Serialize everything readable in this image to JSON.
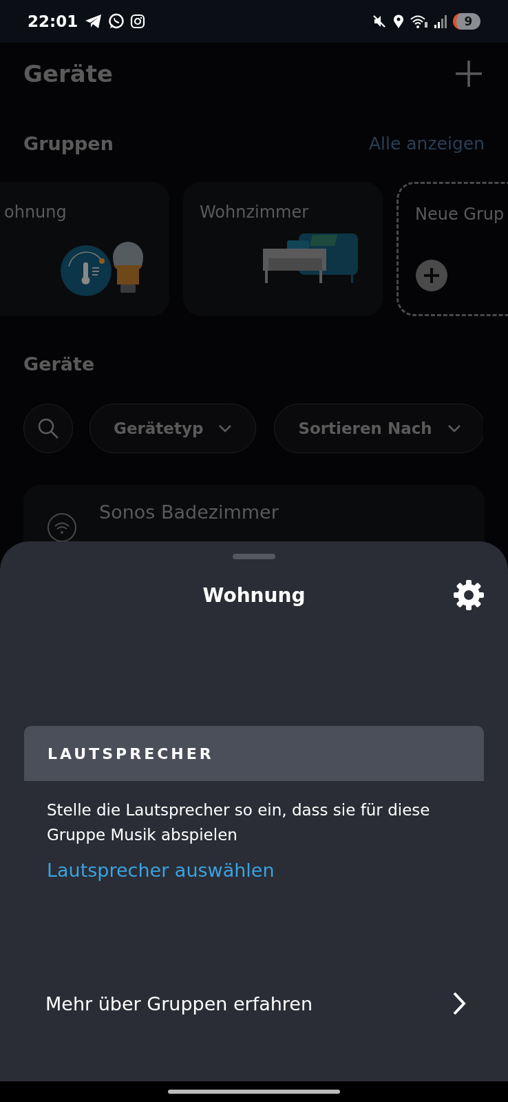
{
  "status_bar": {
    "time": "22:01",
    "battery": "9"
  },
  "header": {
    "title": "Geräte"
  },
  "groups": {
    "title": "Gruppen",
    "link": "Alle anzeigen",
    "items": [
      {
        "kind": "thermo-bulb",
        "name": "ohnung"
      },
      {
        "kind": "sofa",
        "name": "Wohnzimmer"
      },
      {
        "kind": "new",
        "name": "Neue Grup"
      }
    ]
  },
  "devices": {
    "title": "Geräte",
    "filters": [
      "Gerätetyp",
      "Sortieren Nach"
    ],
    "items": [
      {
        "name": "Sonos Badezimmer"
      }
    ]
  },
  "sheet": {
    "title": "Wohnung",
    "section": {
      "heading": "LAUTSPRECHER",
      "text": "Stelle die Lautsprecher so ein, dass sie für diese Gruppe Musik abspielen",
      "link": "Lautsprecher auswählen"
    },
    "more": "Mehr über Gruppen erfahren"
  }
}
